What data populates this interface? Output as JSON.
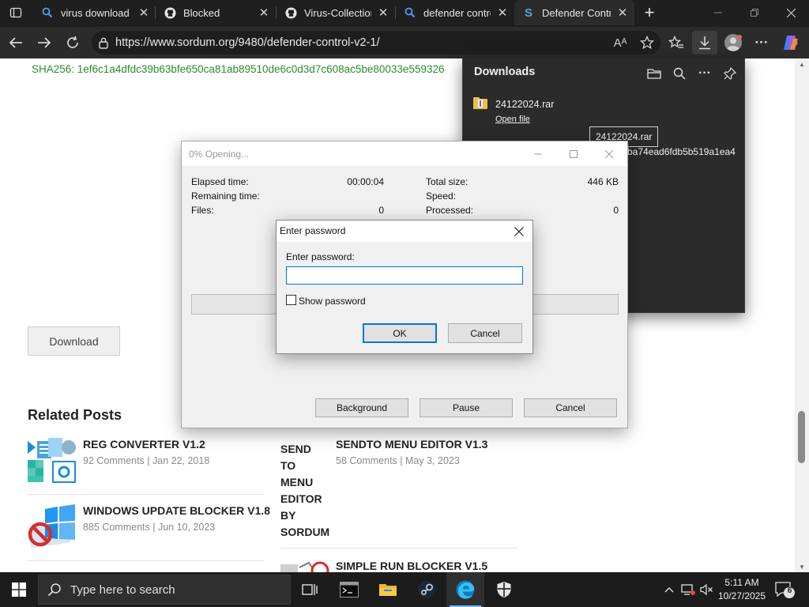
{
  "browser": {
    "tabs": [
      {
        "label": "virus download g",
        "icon": "search-icon"
      },
      {
        "label": "Blocked",
        "icon": "github-icon"
      },
      {
        "label": "Virus-Collection/",
        "icon": "github-icon"
      },
      {
        "label": "defender control",
        "icon": "search-icon"
      },
      {
        "label": "Defender Contro",
        "icon": "sordum-icon",
        "active": true
      }
    ],
    "url": "https://www.sordum.org/9480/defender-control-v2-1/",
    "read_aloud_label": "Aᴬ"
  },
  "page": {
    "sha256": "SHA256: 1ef6c1a4dfdc39b63bfe650ca81ab89510de6c0d3d7c608ac5be80033e559326",
    "download_button": "Download",
    "related_title": "Related Posts",
    "posts": [
      {
        "title": "REG CONVERTER V1.2",
        "meta": "92 Comments | Jan 22, 2018"
      },
      {
        "title": "SENDTO MENU EDITOR V1.3",
        "meta": "58 Comments | May 3, 2023"
      },
      {
        "title": "WINDOWS UPDATE BLOCKER V1.8",
        "meta": "885 Comments | Jun 10, 2023"
      },
      {
        "title": "SIMPLE RUN BLOCKER V1.5",
        "meta": ""
      }
    ],
    "broken_image_alt": "SEND TO MENU EDITOR BY SORDUM"
  },
  "downloads": {
    "title": "Downloads",
    "file_name": "24122024.rar",
    "open_file": "Open file",
    "hash_fragment": "ba74ead6fdb5b519a1ea4",
    "tooltip": "24122024.rar"
  },
  "progress_window": {
    "title": "0% Opening...",
    "elapsed_label": "Elapsed time:",
    "elapsed_value": "00:00:04",
    "remaining_label": "Remaining time:",
    "files_label": "Files:",
    "files_value": "0",
    "total_size_label": "Total size:",
    "total_size_value": "446 KB",
    "speed_label": "Speed:",
    "processed_label": "Processed:",
    "processed_value": "0",
    "progress": 0,
    "background_button": "Background",
    "pause_button": "Pause",
    "cancel_button": "Cancel"
  },
  "password_dialog": {
    "title": "Enter password",
    "field_label": "Enter password:",
    "password_value": "",
    "show_password_label": "Show password",
    "show_password_checked": false,
    "ok_button": "OK",
    "cancel_button": "Cancel"
  },
  "taskbar": {
    "search_placeholder": "Type here to search",
    "time": "5:11 AM",
    "date": "10/27/2025",
    "notification_count": "6"
  },
  "colors": {
    "sha_green": "#2e8b2e",
    "accent_blue": "#0078d7",
    "chrome_dark": "#1f1f1f"
  }
}
